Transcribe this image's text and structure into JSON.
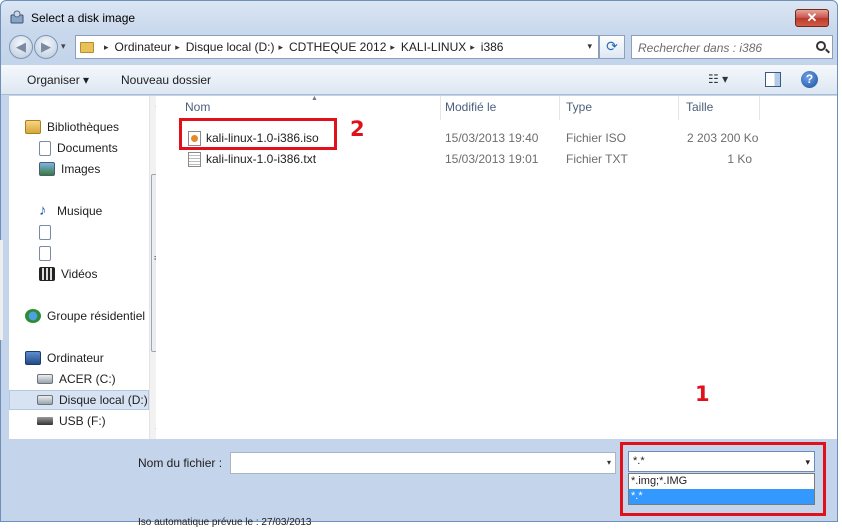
{
  "window": {
    "title": "Select a disk image",
    "close_symbol": "✕",
    "accent_color": "#c75050"
  },
  "navigation": {
    "back_symbol": "◀",
    "forward_symbol": "▶",
    "history_symbol": "▾",
    "breadcrumb": [
      "Ordinateur",
      "Disque local (D:)",
      "CDTHEQUE 2012",
      "KALI-LINUX",
      "i386"
    ],
    "breadcrumb_separator": "▸",
    "address_dropdown_symbol": "▾",
    "refresh_symbol": "⟳",
    "search_placeholder": "Rechercher dans : i386"
  },
  "toolbar": {
    "organiser_label": "Organiser ▾",
    "new_folder_label": "Nouveau dossier",
    "view_symbol": "☷ ▾",
    "help_symbol": "?"
  },
  "sidebar": {
    "items": [
      {
        "label": "Bibliothèques",
        "icon": "library-icon"
      },
      {
        "label": "Documents",
        "icon": "document-icon"
      },
      {
        "label": "Images",
        "icon": "image-icon"
      },
      {
        "label": "",
        "icon": "blank"
      },
      {
        "label": "Musique",
        "icon": "music-icon"
      },
      {
        "label": "",
        "icon": "document-icon"
      },
      {
        "label": "",
        "icon": "document-icon"
      },
      {
        "label": "Vidéos",
        "icon": "video-icon"
      },
      {
        "label": "Groupe résidentiel",
        "icon": "homegroup-icon"
      },
      {
        "label": "Ordinateur",
        "icon": "computer-icon"
      },
      {
        "label": "ACER (C:)",
        "icon": "drive-icon"
      },
      {
        "label": "Disque local (D:)",
        "icon": "drive-icon",
        "selected": true
      },
      {
        "label": "USB (F:)",
        "icon": "usb-drive-icon"
      }
    ],
    "music_glyph": "♪",
    "scroll_up": "▲",
    "scroll_down": "▼",
    "scroll_grip": "≡"
  },
  "file_list": {
    "columns": [
      "Nom",
      "Modifié le",
      "Type",
      "Taille"
    ],
    "sort_indicator": "▲",
    "rows": [
      {
        "name": "kali-linux-1.0-i386.iso",
        "modified": "15/03/2013 19:40",
        "type": "Fichier ISO",
        "size": "2 203 200 Ko"
      },
      {
        "name": "kali-linux-1.0-i386.txt",
        "modified": "15/03/2013 19:01",
        "type": "Fichier TXT",
        "size": "1 Ko"
      }
    ]
  },
  "footer": {
    "filename_label": "Nom du fichier :",
    "filename_value": "",
    "filename_dropdown_symbol": "▾",
    "filter_selected": "*.*",
    "filter_dropdown_symbol": "▾",
    "filter_options": [
      "*.img;*.IMG",
      "*.*"
    ]
  },
  "annotations": {
    "marker_1": "1",
    "marker_2": "2",
    "color": "#e0111a"
  },
  "background_text": "Iso automatique prévue le : 27/03/2013"
}
